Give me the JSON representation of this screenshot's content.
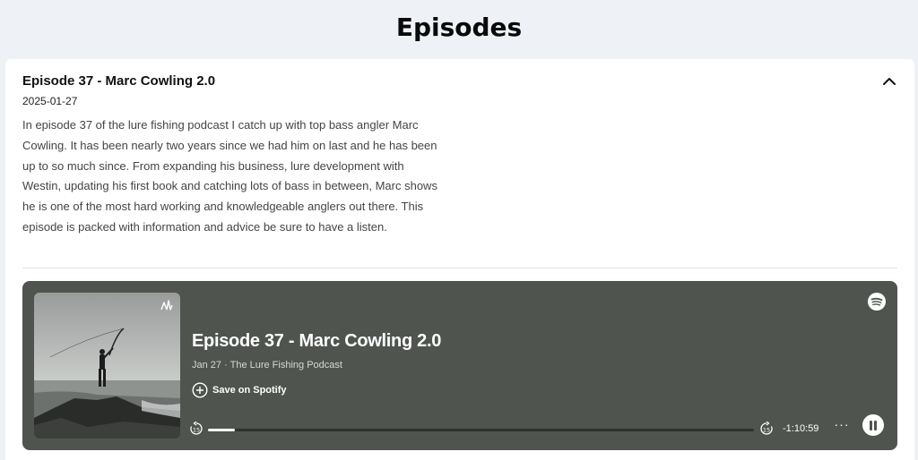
{
  "page": {
    "title": "Episodes"
  },
  "episode": {
    "title": "Episode 37 - Marc Cowling 2.0",
    "date": "2025-01-27",
    "description": "In episode 37 of the lure fishing podcast I catch up with top bass angler Marc Cowling. It has been nearly two years since we had him on last and he has been up to so much since. From expanding his business, lure development with Westin, updating his first book and catching lots of bass in between, Marc shows he is one of the most hard working and knowledgeable anglers out there. This episode is packed with information and advice be sure to have a listen.",
    "collapse_icon": "chevron-up-icon"
  },
  "player": {
    "title": "Episode 37 - Marc Cowling 2.0",
    "meta": "Jan 27 · The Lure Fishing Podcast",
    "save_label": "Save on Spotify",
    "time_remaining": "-1:10:59",
    "more_label": "···",
    "progress_percent": 5,
    "skip_back_seconds": "15",
    "skip_forward_seconds": "15",
    "state": "playing",
    "colors": {
      "background": "#4f544f",
      "text": "#ffffff"
    }
  }
}
